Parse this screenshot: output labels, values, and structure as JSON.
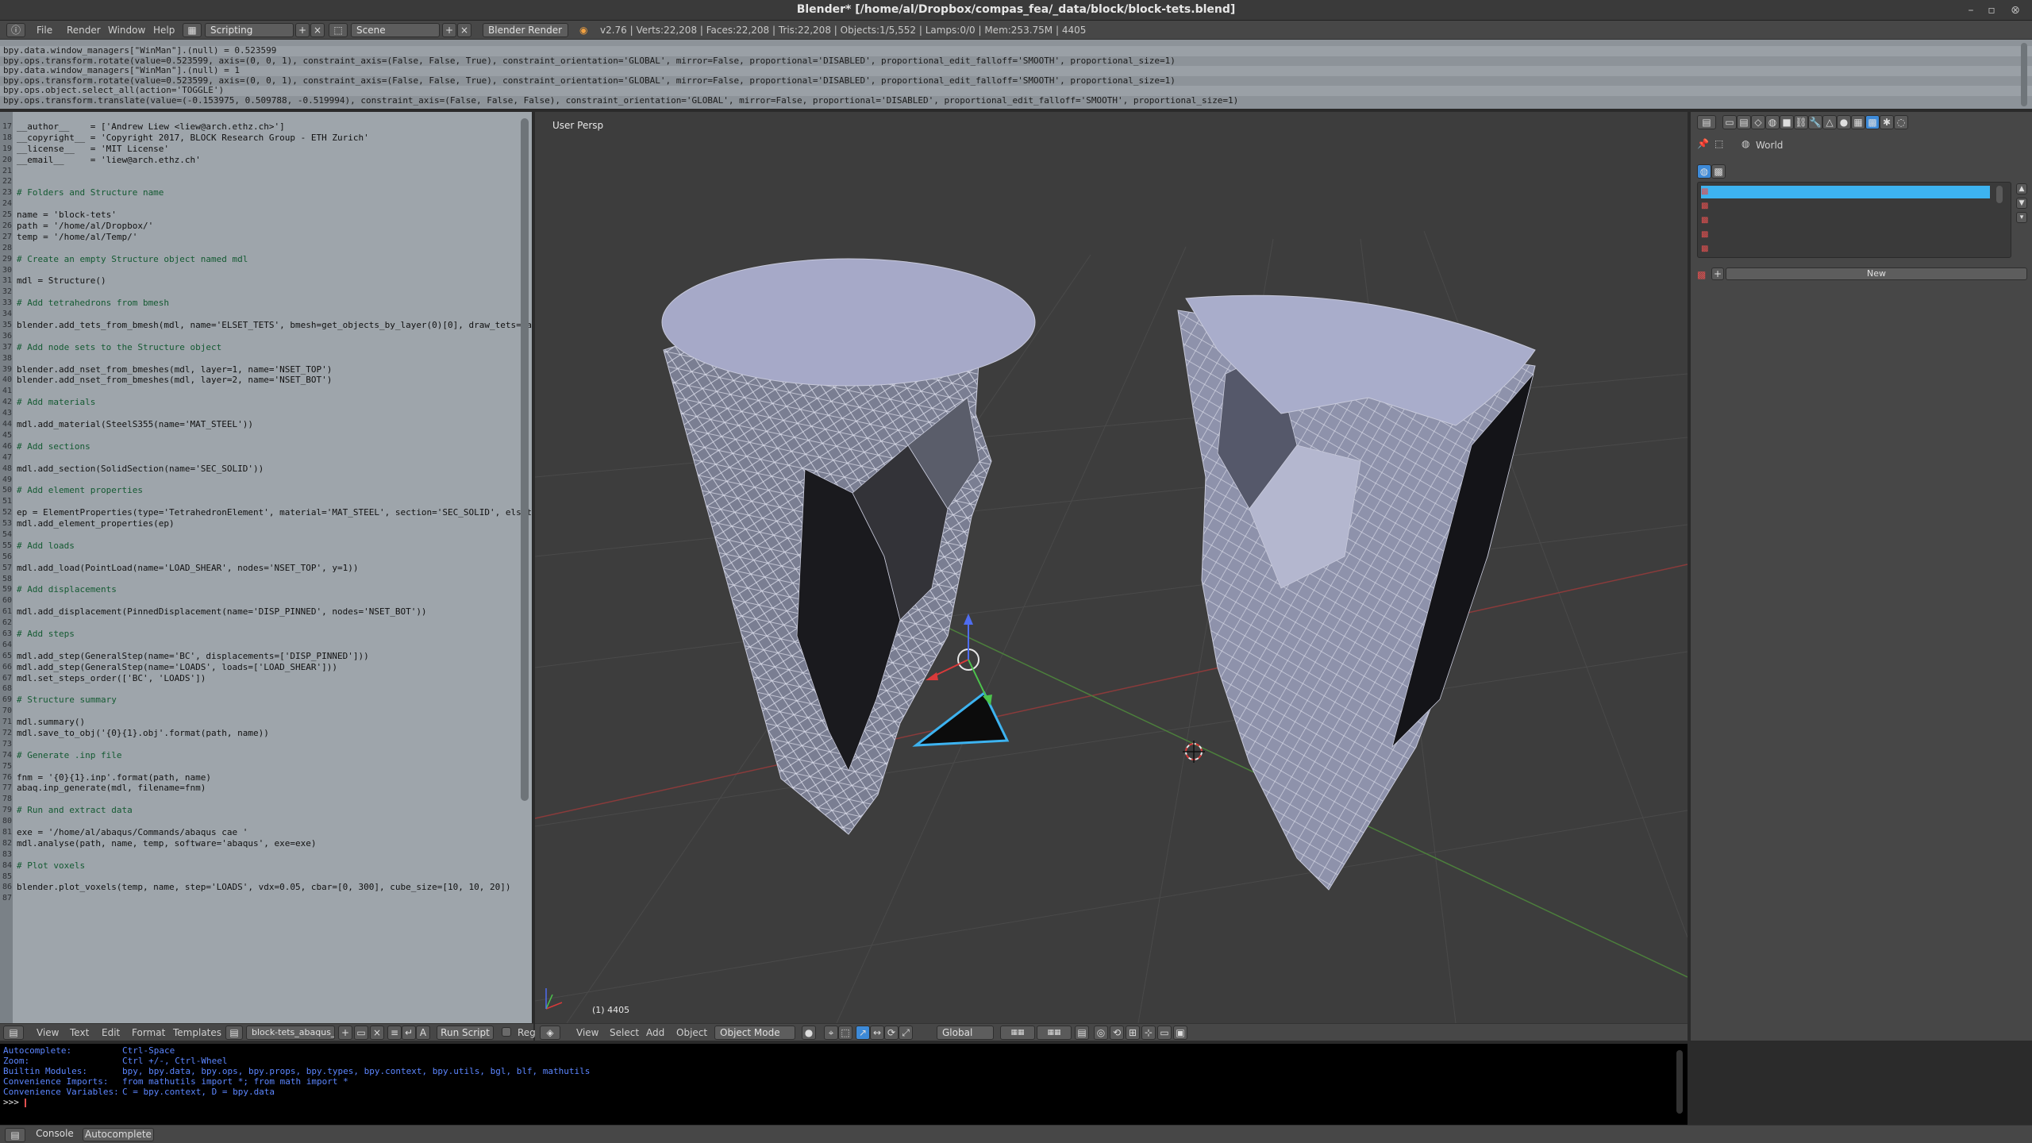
{
  "window": {
    "title": "Blender* [/home/al/Dropbox/compas_fea/_data/block/block-tets.blend]"
  },
  "info_header": {
    "menus": [
      "File",
      "Render",
      "Window",
      "Help"
    ],
    "screen_layout": "Scripting",
    "scene": "Scene",
    "render_engine": "Blender Render",
    "stats": "v2.76 | Verts:22,208 | Faces:22,208 | Tris:22,208 | Objects:1/5,552 | Lamps:0/0 | Mem:253.75M | 4405"
  },
  "report_lines": [
    "bpy.data.window_managers[\"WinMan\"].(null) = 0.523599",
    "bpy.ops.transform.rotate(value=0.523599, axis=(0, 0, 1), constraint_axis=(False, False, True), constraint_orientation='GLOBAL', mirror=False, proportional='DISABLED', proportional_edit_falloff='SMOOTH', proportional_size=1)",
    "bpy.data.window_managers[\"WinMan\"].(null) = 1",
    "bpy.ops.transform.rotate(value=0.523599, axis=(0, 0, 1), constraint_axis=(False, False, True), constraint_orientation='GLOBAL', mirror=False, proportional='DISABLED', proportional_edit_falloff='SMOOTH', proportional_size=1)",
    "bpy.ops.object.select_all(action='TOGGLE')",
    "bpy.ops.transform.translate(value=(-0.153975, 0.509788, -0.519994), constraint_axis=(False, False, False), constraint_orientation='GLOBAL', mirror=False, proportional='DISABLED', proportional_edit_falloff='SMOOTH', proportional_size=1)"
  ],
  "code_lines": [
    {
      "n": "17",
      "t": "__author__    = ['Andrew Liew <liew@arch.ethz.ch>']"
    },
    {
      "n": "18",
      "t": "__copyright__ = 'Copyright 2017, BLOCK Research Group - ETH Zurich'"
    },
    {
      "n": "19",
      "t": "__license__   = 'MIT License'"
    },
    {
      "n": "20",
      "t": "__email__     = 'liew@arch.ethz.ch'"
    },
    {
      "n": "21",
      "t": ""
    },
    {
      "n": "22",
      "t": ""
    },
    {
      "n": "23",
      "t": "# Folders and Structure name"
    },
    {
      "n": "24",
      "t": ""
    },
    {
      "n": "25",
      "t": "name = 'block-tets'"
    },
    {
      "n": "26",
      "t": "path = '/home/al/Dropbox/'"
    },
    {
      "n": "27",
      "t": "temp = '/home/al/Temp/'"
    },
    {
      "n": "28",
      "t": ""
    },
    {
      "n": "29",
      "t": "# Create an empty Structure object named mdl"
    },
    {
      "n": "30",
      "t": ""
    },
    {
      "n": "31",
      "t": "mdl = Structure()"
    },
    {
      "n": "32",
      "t": ""
    },
    {
      "n": "33",
      "t": "# Add tetrahedrons from bmesh"
    },
    {
      "n": "34",
      "t": ""
    },
    {
      "n": "35",
      "t": "blender.add_tets_from_bmesh(mdl, name='ELSET_TETS', bmesh=get_objects_by_layer(0)[0], draw_tets=False)"
    },
    {
      "n": "36",
      "t": ""
    },
    {
      "n": "37",
      "t": "# Add node sets to the Structure object"
    },
    {
      "n": "38",
      "t": ""
    },
    {
      "n": "39",
      "t": "blender.add_nset_from_bmeshes(mdl, layer=1, name='NSET_TOP')"
    },
    {
      "n": "40",
      "t": "blender.add_nset_from_bmeshes(mdl, layer=2, name='NSET_BOT')"
    },
    {
      "n": "41",
      "t": ""
    },
    {
      "n": "42",
      "t": "# Add materials"
    },
    {
      "n": "43",
      "t": ""
    },
    {
      "n": "44",
      "t": "mdl.add_material(SteelS355(name='MAT_STEEL'))"
    },
    {
      "n": "45",
      "t": ""
    },
    {
      "n": "46",
      "t": "# Add sections"
    },
    {
      "n": "47",
      "t": ""
    },
    {
      "n": "48",
      "t": "mdl.add_section(SolidSection(name='SEC_SOLID'))"
    },
    {
      "n": "49",
      "t": ""
    },
    {
      "n": "50",
      "t": "# Add element properties"
    },
    {
      "n": "51",
      "t": ""
    },
    {
      "n": "52",
      "t": "ep = ElementProperties(type='TetrahedronElement', material='MAT_STEEL', section='SEC_SOLID', elsets='ELSET"
    },
    {
      "n": "53",
      "t": "mdl.add_element_properties(ep)"
    },
    {
      "n": "54",
      "t": ""
    },
    {
      "n": "55",
      "t": "# Add loads"
    },
    {
      "n": "56",
      "t": ""
    },
    {
      "n": "57",
      "t": "mdl.add_load(PointLoad(name='LOAD_SHEAR', nodes='NSET_TOP', y=1))"
    },
    {
      "n": "58",
      "t": ""
    },
    {
      "n": "59",
      "t": "# Add displacements"
    },
    {
      "n": "60",
      "t": ""
    },
    {
      "n": "61",
      "t": "mdl.add_displacement(PinnedDisplacement(name='DISP_PINNED', nodes='NSET_BOT'))"
    },
    {
      "n": "62",
      "t": ""
    },
    {
      "n": "63",
      "t": "# Add steps"
    },
    {
      "n": "64",
      "t": ""
    },
    {
      "n": "65",
      "t": "mdl.add_step(GeneralStep(name='BC', displacements=['DISP_PINNED']))"
    },
    {
      "n": "66",
      "t": "mdl.add_step(GeneralStep(name='LOADS', loads=['LOAD_SHEAR']))"
    },
    {
      "n": "67",
      "t": "mdl.set_steps_order(['BC', 'LOADS'])"
    },
    {
      "n": "68",
      "t": ""
    },
    {
      "n": "69",
      "t": "# Structure summary"
    },
    {
      "n": "70",
      "t": ""
    },
    {
      "n": "71",
      "t": "mdl.summary()"
    },
    {
      "n": "72",
      "t": "mdl.save_to_obj('{0}{1}.obj'.format(path, name))"
    },
    {
      "n": "73",
      "t": ""
    },
    {
      "n": "74",
      "t": "# Generate .inp file"
    },
    {
      "n": "75",
      "t": ""
    },
    {
      "n": "76",
      "t": "fnm = '{0}{1}.inp'.format(path, name)"
    },
    {
      "n": "77",
      "t": "abaq.inp_generate(mdl, filename=fnm)"
    },
    {
      "n": "78",
      "t": ""
    },
    {
      "n": "79",
      "t": "# Run and extract data"
    },
    {
      "n": "80",
      "t": ""
    },
    {
      "n": "81",
      "t": "exe = '/home/al/abaqus/Commands/abaqus cae '"
    },
    {
      "n": "82",
      "t": "mdl.analyse(path, name, temp, software='abaqus', exe=exe)"
    },
    {
      "n": "83",
      "t": ""
    },
    {
      "n": "84",
      "t": "# Plot voxels"
    },
    {
      "n": "85",
      "t": ""
    },
    {
      "n": "86",
      "t": "blender.plot_voxels(temp, name, step='LOADS', vdx=0.05, cbar=[0, 300], cube_size=[10, 10, 20])"
    },
    {
      "n": "87",
      "t": ""
    }
  ],
  "text_editor_header": {
    "menus": [
      "View",
      "Text",
      "Edit",
      "Format",
      "Templates"
    ],
    "filename": "block-tets_abaqus_...",
    "run_script": "Run Script",
    "reg": "Reg"
  },
  "viewport": {
    "view_label": "User Persp",
    "frame_label": "(1) 4405",
    "menus": [
      "View",
      "Select",
      "Add",
      "Object"
    ],
    "mode": "Object Mode",
    "orientation": "Global"
  },
  "properties": {
    "world_label": "World",
    "new_button": "New"
  },
  "console": {
    "lines": [
      {
        "k": "Autocomplete:",
        "v": "Ctrl-Space"
      },
      {
        "k": "Zoom:",
        "v": "Ctrl +/-, Ctrl-Wheel"
      },
      {
        "k": "Builtin Modules:",
        "v": "bpy, bpy.data, bpy.ops, bpy.props, bpy.types, bpy.context, bpy.utils, bgl, blf, mathutils"
      },
      {
        "k": "Convenience Imports:",
        "v": "from mathutils import *; from math import *"
      },
      {
        "k": "Convenience Variables:",
        "v": "C = bpy.context, D = bpy.data"
      }
    ],
    "prompt": ">>> ",
    "tabs": [
      "Console",
      "Autocomplete"
    ]
  },
  "colors": {
    "text_bg": "#9ea5ab",
    "viewport_bg": "#3d3d3d",
    "accent": "#3db3f0",
    "console_blue": "#5c86ff"
  }
}
